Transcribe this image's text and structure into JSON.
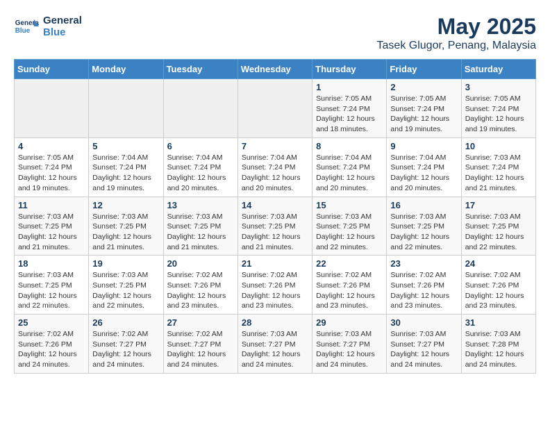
{
  "logo": {
    "line1": "General",
    "line2": "Blue"
  },
  "title": "May 2025",
  "subtitle": "Tasek Glugor, Penang, Malaysia",
  "days_of_week": [
    "Sunday",
    "Monday",
    "Tuesday",
    "Wednesday",
    "Thursday",
    "Friday",
    "Saturday"
  ],
  "weeks": [
    [
      {
        "day": "",
        "info": ""
      },
      {
        "day": "",
        "info": ""
      },
      {
        "day": "",
        "info": ""
      },
      {
        "day": "",
        "info": ""
      },
      {
        "day": "1",
        "info": "Sunrise: 7:05 AM\nSunset: 7:24 PM\nDaylight: 12 hours\nand 18 minutes."
      },
      {
        "day": "2",
        "info": "Sunrise: 7:05 AM\nSunset: 7:24 PM\nDaylight: 12 hours\nand 19 minutes."
      },
      {
        "day": "3",
        "info": "Sunrise: 7:05 AM\nSunset: 7:24 PM\nDaylight: 12 hours\nand 19 minutes."
      }
    ],
    [
      {
        "day": "4",
        "info": "Sunrise: 7:05 AM\nSunset: 7:24 PM\nDaylight: 12 hours\nand 19 minutes."
      },
      {
        "day": "5",
        "info": "Sunrise: 7:04 AM\nSunset: 7:24 PM\nDaylight: 12 hours\nand 19 minutes."
      },
      {
        "day": "6",
        "info": "Sunrise: 7:04 AM\nSunset: 7:24 PM\nDaylight: 12 hours\nand 20 minutes."
      },
      {
        "day": "7",
        "info": "Sunrise: 7:04 AM\nSunset: 7:24 PM\nDaylight: 12 hours\nand 20 minutes."
      },
      {
        "day": "8",
        "info": "Sunrise: 7:04 AM\nSunset: 7:24 PM\nDaylight: 12 hours\nand 20 minutes."
      },
      {
        "day": "9",
        "info": "Sunrise: 7:04 AM\nSunset: 7:24 PM\nDaylight: 12 hours\nand 20 minutes."
      },
      {
        "day": "10",
        "info": "Sunrise: 7:03 AM\nSunset: 7:24 PM\nDaylight: 12 hours\nand 21 minutes."
      }
    ],
    [
      {
        "day": "11",
        "info": "Sunrise: 7:03 AM\nSunset: 7:25 PM\nDaylight: 12 hours\nand 21 minutes."
      },
      {
        "day": "12",
        "info": "Sunrise: 7:03 AM\nSunset: 7:25 PM\nDaylight: 12 hours\nand 21 minutes."
      },
      {
        "day": "13",
        "info": "Sunrise: 7:03 AM\nSunset: 7:25 PM\nDaylight: 12 hours\nand 21 minutes."
      },
      {
        "day": "14",
        "info": "Sunrise: 7:03 AM\nSunset: 7:25 PM\nDaylight: 12 hours\nand 21 minutes."
      },
      {
        "day": "15",
        "info": "Sunrise: 7:03 AM\nSunset: 7:25 PM\nDaylight: 12 hours\nand 22 minutes."
      },
      {
        "day": "16",
        "info": "Sunrise: 7:03 AM\nSunset: 7:25 PM\nDaylight: 12 hours\nand 22 minutes."
      },
      {
        "day": "17",
        "info": "Sunrise: 7:03 AM\nSunset: 7:25 PM\nDaylight: 12 hours\nand 22 minutes."
      }
    ],
    [
      {
        "day": "18",
        "info": "Sunrise: 7:03 AM\nSunset: 7:25 PM\nDaylight: 12 hours\nand 22 minutes."
      },
      {
        "day": "19",
        "info": "Sunrise: 7:03 AM\nSunset: 7:25 PM\nDaylight: 12 hours\nand 22 minutes."
      },
      {
        "day": "20",
        "info": "Sunrise: 7:02 AM\nSunset: 7:26 PM\nDaylight: 12 hours\nand 23 minutes."
      },
      {
        "day": "21",
        "info": "Sunrise: 7:02 AM\nSunset: 7:26 PM\nDaylight: 12 hours\nand 23 minutes."
      },
      {
        "day": "22",
        "info": "Sunrise: 7:02 AM\nSunset: 7:26 PM\nDaylight: 12 hours\nand 23 minutes."
      },
      {
        "day": "23",
        "info": "Sunrise: 7:02 AM\nSunset: 7:26 PM\nDaylight: 12 hours\nand 23 minutes."
      },
      {
        "day": "24",
        "info": "Sunrise: 7:02 AM\nSunset: 7:26 PM\nDaylight: 12 hours\nand 23 minutes."
      }
    ],
    [
      {
        "day": "25",
        "info": "Sunrise: 7:02 AM\nSunset: 7:26 PM\nDaylight: 12 hours\nand 24 minutes."
      },
      {
        "day": "26",
        "info": "Sunrise: 7:02 AM\nSunset: 7:27 PM\nDaylight: 12 hours\nand 24 minutes."
      },
      {
        "day": "27",
        "info": "Sunrise: 7:02 AM\nSunset: 7:27 PM\nDaylight: 12 hours\nand 24 minutes."
      },
      {
        "day": "28",
        "info": "Sunrise: 7:03 AM\nSunset: 7:27 PM\nDaylight: 12 hours\nand 24 minutes."
      },
      {
        "day": "29",
        "info": "Sunrise: 7:03 AM\nSunset: 7:27 PM\nDaylight: 12 hours\nand 24 minutes."
      },
      {
        "day": "30",
        "info": "Sunrise: 7:03 AM\nSunset: 7:27 PM\nDaylight: 12 hours\nand 24 minutes."
      },
      {
        "day": "31",
        "info": "Sunrise: 7:03 AM\nSunset: 7:28 PM\nDaylight: 12 hours\nand 24 minutes."
      }
    ]
  ]
}
